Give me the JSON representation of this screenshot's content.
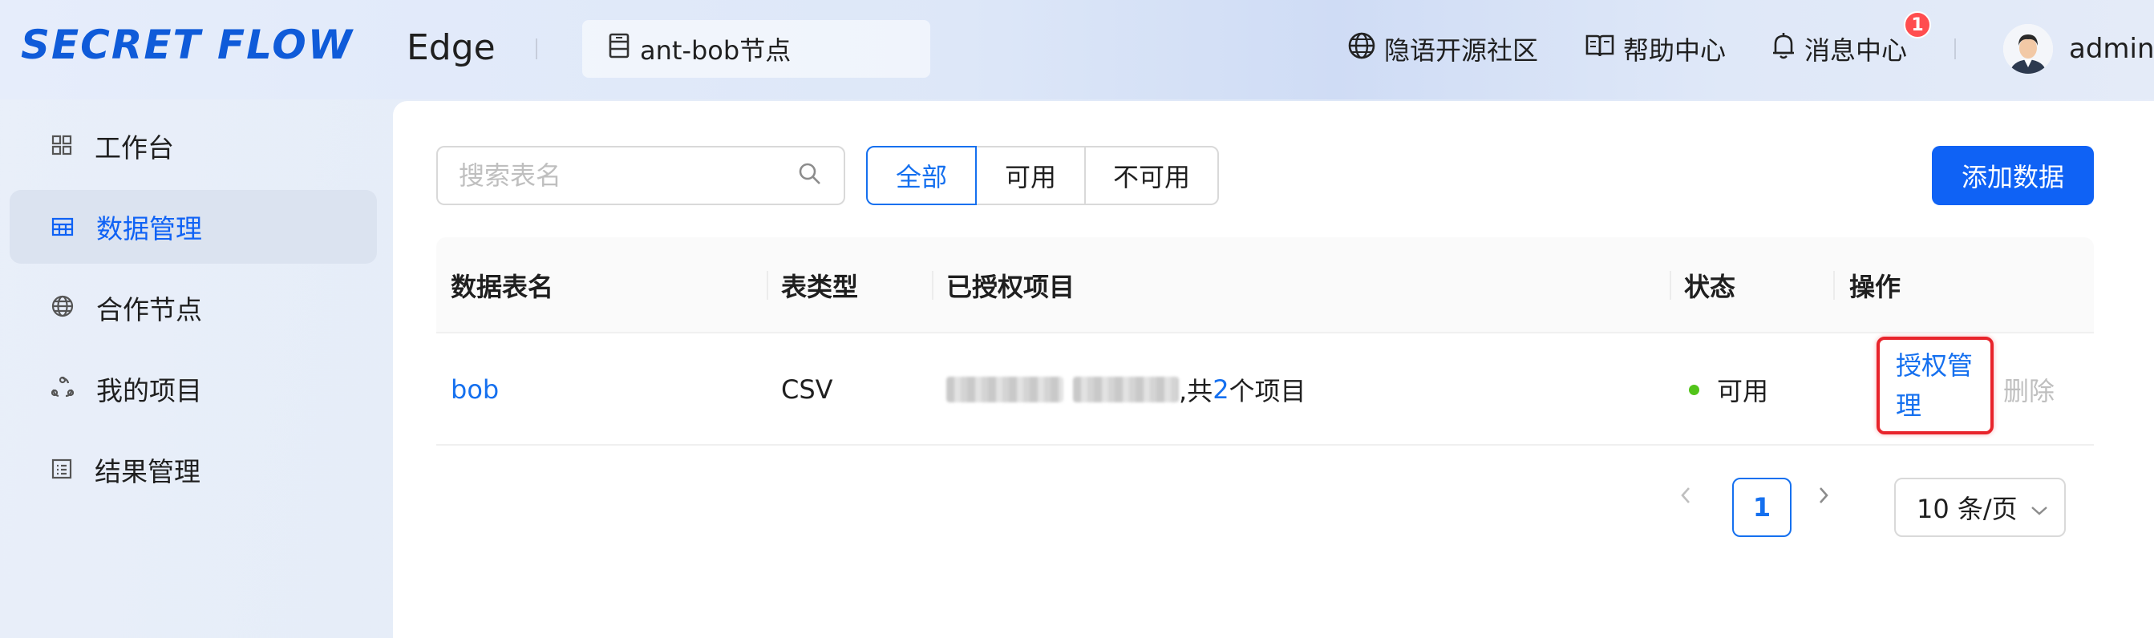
{
  "header": {
    "logo_text": "SECRET FLOW",
    "product": "Edge",
    "node_name": "ant-bob节点",
    "links": {
      "community": "隐语开源社区",
      "help": "帮助中心",
      "messages": "消息中心"
    },
    "message_badge": "1",
    "user": "admin"
  },
  "sidebar": {
    "items": [
      {
        "label": "工作台",
        "icon": "dashboard-icon"
      },
      {
        "label": "数据管理",
        "icon": "table-icon",
        "active": true
      },
      {
        "label": "合作节点",
        "icon": "globe-icon"
      },
      {
        "label": "我的项目",
        "icon": "project-icon"
      },
      {
        "label": "结果管理",
        "icon": "result-list-icon"
      }
    ]
  },
  "toolbar": {
    "search_placeholder": "搜索表名",
    "filters": [
      "全部",
      "可用",
      "不可用"
    ],
    "active_filter": "全部",
    "add_label": "添加数据"
  },
  "table": {
    "columns": [
      "数据表名",
      "表类型",
      "已授权项目",
      "状态",
      "操作"
    ],
    "rows": [
      {
        "name": "bob",
        "type": "CSV",
        "projects_prefix": ",共",
        "projects_count": "2",
        "projects_suffix": "个项目",
        "status": "可用",
        "action_auth": "授权管理",
        "action_delete": "删除"
      }
    ]
  },
  "pagination": {
    "current_page": "1",
    "page_size": "10 条/页"
  },
  "colors": {
    "primary": "#0f62f5",
    "link": "#1570ef",
    "status_ok": "#52c41a",
    "highlight_border": "#e8242b",
    "badge": "#ff4d4f"
  }
}
